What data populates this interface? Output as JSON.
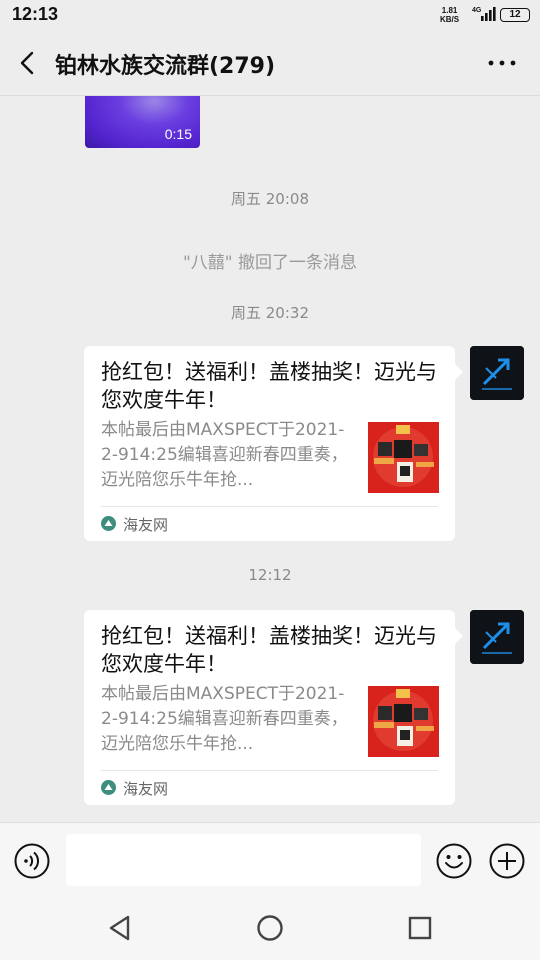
{
  "status_bar": {
    "time": "12:13",
    "net_speed_value": "1.81",
    "net_speed_unit": "KB/S",
    "network_type": "4G",
    "battery": "12"
  },
  "header": {
    "title": "铂林水族交流群(279)"
  },
  "messages": {
    "video": {
      "duration": "0:15"
    },
    "time1": "周五 20:08",
    "recall": "\"八囍\" 撤回了一条消息",
    "time2": "周五 20:32",
    "time3": "12:12",
    "cards": [
      {
        "title": "抢红包！送福利！盖楼抽奖！迈光与您欢度牛年！",
        "description": "本帖最后由MAXSPECT于2021-2-914:25编辑喜迎新春四重奏，迈光陪您乐牛年抢...",
        "source": "海友网"
      },
      {
        "title": "抢红包！送福利！盖楼抽奖！迈光与您欢度牛年！",
        "description": "本帖最后由MAXSPECT于2021-2-914:25编辑喜迎新春四重奏，迈光陪您乐牛年抢...",
        "source": "海友网"
      }
    ]
  },
  "input": {
    "value": "",
    "placeholder": ""
  },
  "icons": {
    "back": "chevron-left-icon",
    "more": "more-dots-icon",
    "voice": "voice-icon",
    "emoji": "emoji-icon",
    "plus": "plus-icon",
    "nav_back": "triangle-back-icon",
    "nav_home": "circle-home-icon",
    "nav_recent": "square-recent-icon"
  },
  "colors": {
    "background": "#ededed",
    "card": "#ffffff",
    "timestamp_text": "#8a8a8a",
    "card_thumb_red": "#d8231d",
    "source_icon": "#3e8e7e"
  }
}
